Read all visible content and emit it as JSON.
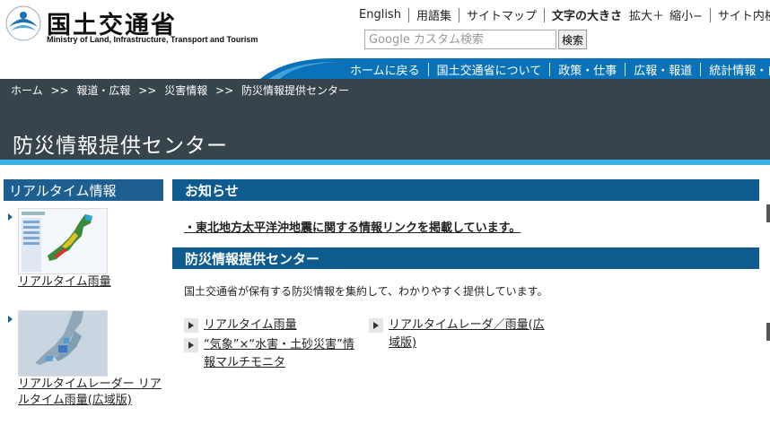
{
  "header": {
    "logo_ja": "国土交通省",
    "logo_en": "Ministry of Land, Infrastructure, Transport and Tourism",
    "util": {
      "english": "English",
      "glossary": "用語集",
      "sitemap": "サイトマップ",
      "font_size_label": "文字の大きさ",
      "enlarge": "拡大＋",
      "shrink": "縮小−",
      "site_search": "サイト内検"
    },
    "search": {
      "placeholder": "Google カスタム検索",
      "button": "検索"
    },
    "nav": [
      "ホームに戻る",
      "国土交通省について",
      "政策・仕事",
      "広報・報道",
      "統計情報・白書"
    ]
  },
  "breadcrumb": {
    "home": "ホーム",
    "press": "報道・広報",
    "disaster": "災害情報",
    "current": "防災情報提供センター",
    "sep": ">>"
  },
  "page_title": "防災情報提供センター",
  "sidebar": {
    "heading": "リアルタイム情報",
    "items": [
      {
        "label": "リアルタイム雨量",
        "thumb_icon": "rainfall-map-thumbnail"
      },
      {
        "label": "リアルタイムレーダー リアルタイム雨量(広域版)",
        "thumb_icon": "radar-map-thumbnail"
      }
    ]
  },
  "notice": {
    "heading": "お知らせ",
    "item": "・東北地方太平洋沖地震に関する情報リンクを掲載しています。"
  },
  "center": {
    "heading": "防災情報提供センター",
    "intro": "国土交通省が保有する防災情報を集約して、わかりやすく提供しています。",
    "links": [
      "リアルタイム雨量",
      "“気象”×“水害・土砂災害”情報マルチモニタ",
      "リアルタイムレーダ／雨量(広域版)"
    ]
  },
  "colors": {
    "nav_blue": "#0a72b8",
    "band": "#37444c",
    "accent": "#3ab0e2",
    "section_head": "#0d5b8f"
  }
}
